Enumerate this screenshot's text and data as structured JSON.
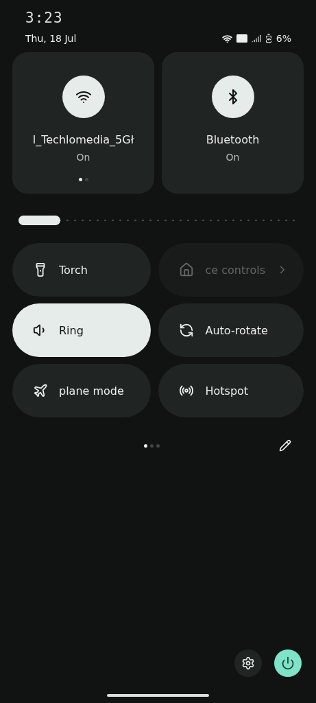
{
  "status_bar": {
    "time": "3:23",
    "date": "Thu, 18 Jul",
    "battery": "6%"
  },
  "big_tiles": [
    {
      "kind": "wifi",
      "title": "l_Techlomedia_5Gł",
      "subtitle": "On",
      "on": true,
      "pager": [
        {
          "selected": true
        },
        {
          "selected": false
        }
      ]
    },
    {
      "kind": "bluetooth",
      "title": "Bluetooth",
      "subtitle": "On",
      "on": true
    }
  ],
  "brightness": {
    "level": 0.15
  },
  "tiles": [
    {
      "kind": "torch",
      "label": "Torch",
      "on": false,
      "disabled": false
    },
    {
      "kind": "home",
      "label": "ce controls",
      "on": false,
      "disabled": true
    },
    {
      "kind": "ring",
      "label": "Ring",
      "on": true,
      "disabled": false
    },
    {
      "kind": "rotate",
      "label": "Auto-rotate",
      "on": false,
      "disabled": false
    },
    {
      "kind": "airplane",
      "label": "plane mode",
      "on": false,
      "disabled": false
    },
    {
      "kind": "hotspot",
      "label": "Hotspot",
      "on": false,
      "disabled": false
    }
  ],
  "pager": [
    {
      "selected": true
    },
    {
      "selected": false
    },
    {
      "selected": false
    }
  ]
}
